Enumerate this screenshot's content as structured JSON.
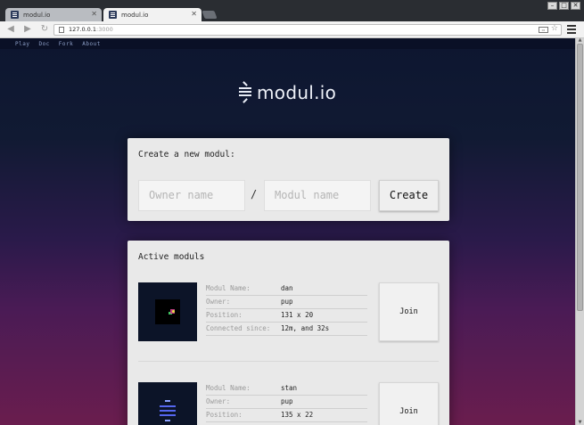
{
  "browser": {
    "tabs": [
      {
        "label": "modul.io",
        "active": false
      },
      {
        "label": "modul.io",
        "active": true
      }
    ],
    "address": {
      "host": "127.0.0.1",
      "port": ":3000"
    }
  },
  "nav": {
    "items": [
      "Play",
      "Doc",
      "Fork",
      "About"
    ]
  },
  "logo": {
    "text": "modul.io"
  },
  "create": {
    "title": "Create a new modul:",
    "owner_placeholder": "Owner name",
    "separator": "/",
    "modul_placeholder": "Modul name",
    "button": "Create"
  },
  "active": {
    "title": "Active moduls",
    "labels": {
      "name": "Modul Name:",
      "owner": "Owner:",
      "position": "Position:",
      "connected": "Connected since:"
    },
    "join_label": "Join",
    "moduls": [
      {
        "name": "dan",
        "owner": "pup",
        "position": "131 x 20",
        "connected": "12m, and 32s"
      },
      {
        "name": "stan",
        "owner": "pup",
        "position": "135 x 22",
        "connected": ""
      }
    ]
  },
  "colors": {
    "accent_dark": "#0d1630",
    "accent_magenta": "#6a1d4e",
    "card": "#e9e9e9"
  }
}
